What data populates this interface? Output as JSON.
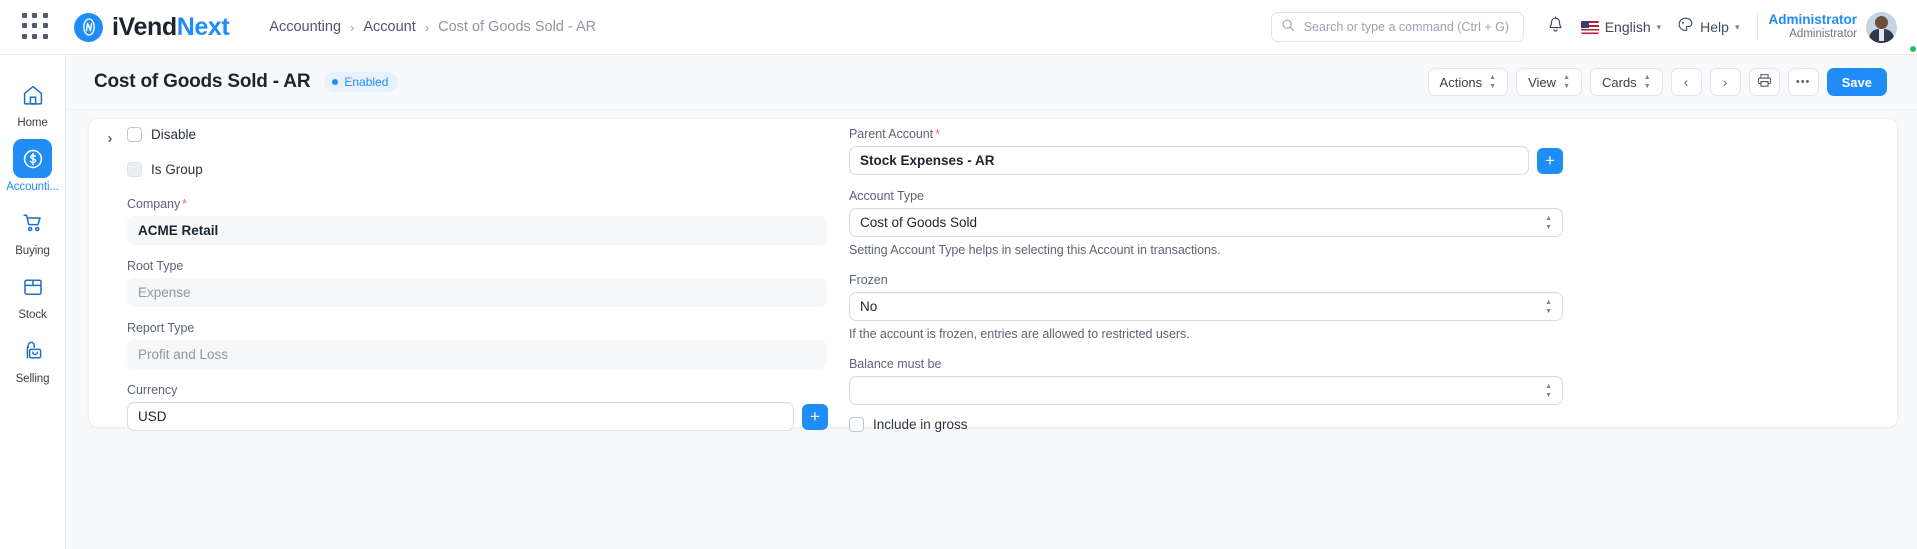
{
  "navbar": {
    "apps_icon": "grid-apps-icon",
    "brand": {
      "part1": "iVend",
      "part2": "Next",
      "logo_icon": "ivendnext-logo-icon"
    },
    "breadcrumb": [
      {
        "label": "Accounting",
        "current": false
      },
      {
        "label": "Account",
        "current": false
      },
      {
        "label": "Cost of Goods Sold - AR",
        "current": true
      }
    ],
    "breadcrumb_separator": "›",
    "search": {
      "placeholder": "Search or type a command (Ctrl + G)",
      "value": "",
      "icon": "search-icon"
    },
    "notifications_icon": "bell-icon",
    "language": {
      "label": "English",
      "caret": "⌄",
      "flag": "us-flag-icon"
    },
    "help": {
      "label": "Help",
      "caret": "⌄",
      "icon": "help-palette-icon"
    },
    "user": {
      "name": "Administrator",
      "role": "Administrator",
      "avatar": "user-avatar"
    }
  },
  "sidebar": {
    "items": [
      {
        "label": "Home",
        "icon": "home-icon",
        "active": false
      },
      {
        "label": "Accounti...",
        "icon": "dollar-circle-icon",
        "active": true
      },
      {
        "label": "Buying",
        "icon": "shopping-cart-icon",
        "active": false
      },
      {
        "label": "Stock",
        "icon": "box-icon",
        "active": false
      },
      {
        "label": "Selling",
        "icon": "selling-bag-icon",
        "active": false
      }
    ]
  },
  "page": {
    "title": "Cost of Goods Sold - AR",
    "status_badge": "Enabled",
    "toolbar": {
      "actions_label": "Actions",
      "view_label": "View",
      "cards_label": "Cards",
      "prev_label": "‹",
      "next_label": "›",
      "print_icon": "printer-icon",
      "more_label": "•••",
      "save_label": "Save"
    }
  },
  "form": {
    "collapse_chevron": "›",
    "left": {
      "disable": {
        "label": "Disable",
        "checked": false,
        "disabled": false
      },
      "is_group": {
        "label": "Is Group",
        "checked": false,
        "disabled": true
      },
      "company": {
        "label": "Company",
        "required": true,
        "value": "ACME Retail",
        "readonly": true
      },
      "root_type": {
        "label": "Root Type",
        "required": false,
        "value": "Expense",
        "readonly": true
      },
      "report_type": {
        "label": "Report Type",
        "required": false,
        "value": "Profit and Loss",
        "readonly": true
      },
      "currency": {
        "label": "Currency",
        "required": false,
        "value": "USD",
        "readonly": false,
        "add_button": "+"
      }
    },
    "right": {
      "parent_account": {
        "label": "Parent Account",
        "required": true,
        "value": "Stock Expenses - AR",
        "add_button": "+"
      },
      "account_type": {
        "label": "Account Type",
        "value": "Cost of Goods Sold",
        "helper": "Setting Account Type helps in selecting this Account in transactions."
      },
      "frozen": {
        "label": "Frozen",
        "value": "No",
        "helper": "If the account is frozen, entries are allowed to restricted users."
      },
      "balance_must_be": {
        "label": "Balance must be",
        "value": ""
      },
      "include_in_gross": {
        "label": "Include in gross",
        "checked": false
      }
    }
  },
  "colors": {
    "accent": "#1f8df5",
    "page_bg": "#f7f9fb",
    "text": "#1b2530",
    "muted": "#5b6676",
    "required": "#e8707a",
    "online": "#22c55e"
  }
}
